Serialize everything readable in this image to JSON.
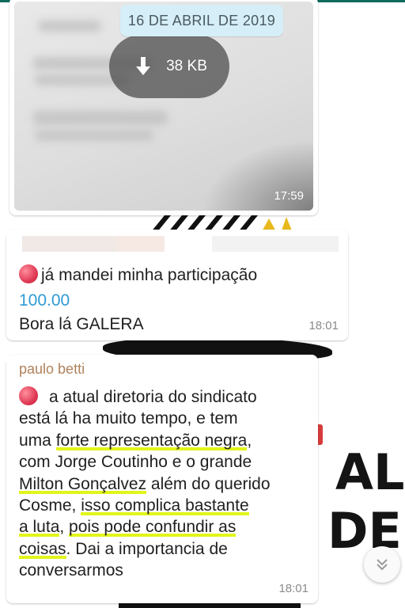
{
  "date_chip": "16 DE ABRIL DE 2019",
  "image_message": {
    "download_size": "38 KB",
    "time": "17:59"
  },
  "message_2": {
    "line1": "já mandei minha participação",
    "amount": "100.00",
    "line3": "Bora lá GALERA",
    "time": "18:01"
  },
  "message_3": {
    "sender": "paulo betti",
    "lines": [
      [
        "",
        "a atual diretoria do sindicato"
      ],
      [
        "",
        "está lá ha muito tempo, e tem"
      ],
      [
        "uma ",
        "forte representação negra",
        ","
      ],
      [
        "",
        "com Jorge Coutinho e o grande"
      ],
      [
        "",
        "Milton Gonçalvez",
        " além do querido"
      ],
      [
        "",
        "Cosme, ",
        "isso complica bastante"
      ],
      [
        "",
        "a luta",
        ", ",
        "pois pode confundir as"
      ],
      [
        "",
        "coisas",
        ". Dai a importancia de"
      ],
      [
        "",
        "conversarmos"
      ]
    ],
    "time": "18:01"
  },
  "wallpaper_text": [
    "AL",
    "DE"
  ],
  "colors": {
    "date_chip_bg": "#d6eef7",
    "sender_name": "#b0825c",
    "amount_link": "#2f9bd3",
    "highlighter": "#e2f51a",
    "status_red": "#e03a55"
  },
  "icons": [
    "download-arrow-icon",
    "red-circle-emoji-icon",
    "scroll-down-chevron-icon"
  ]
}
